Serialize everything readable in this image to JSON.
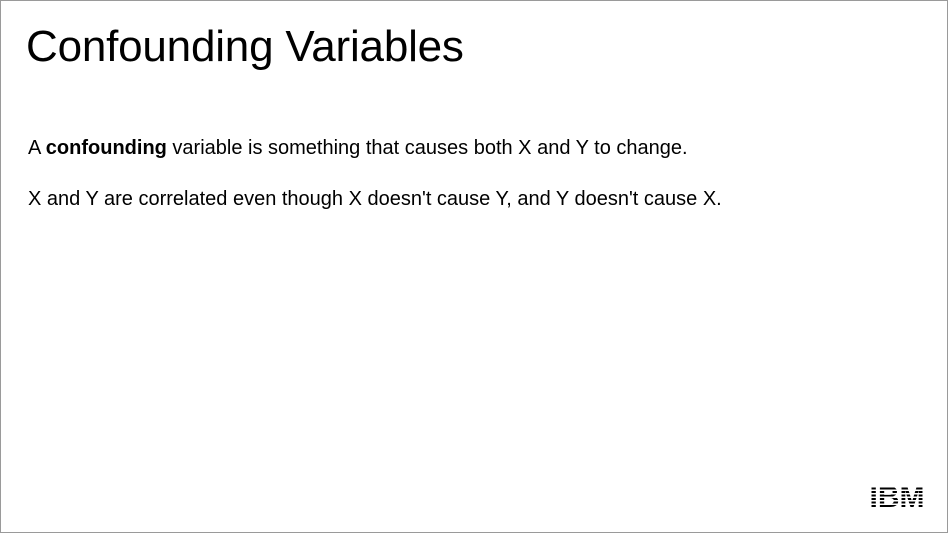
{
  "slide": {
    "title": "Confounding Variables",
    "paragraph_1": {
      "prefix": "A ",
      "emphasis": "confounding",
      "suffix": " variable is something that causes both X and Y to change."
    },
    "paragraph_2": "X and Y are correlated even though X doesn't cause Y, and Y doesn't cause X.",
    "logo": {
      "text": "IBM",
      "icon": "ibm-logo-icon",
      "color": "#000000"
    }
  }
}
